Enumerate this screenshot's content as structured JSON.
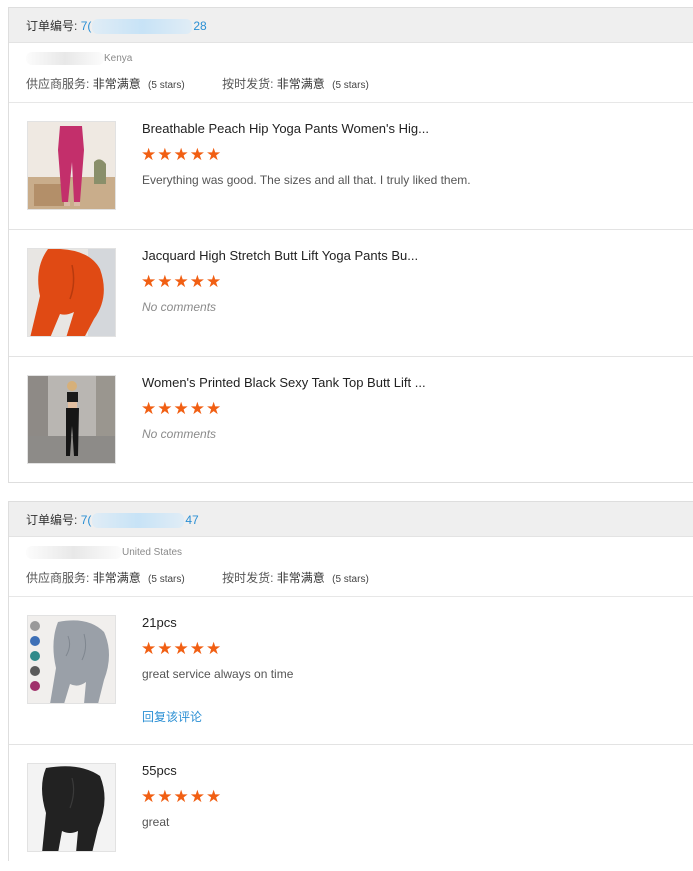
{
  "orders": [
    {
      "order_label": "订单编号:",
      "order_id_start": "7(",
      "order_id_end": "28",
      "buyer_country": "Kenya",
      "supplier_service_label": "供应商服务:",
      "supplier_service_value": "非常满意",
      "supplier_service_stars": "(5 stars)",
      "shipping_label": "按时发货:",
      "shipping_value": "非常满意",
      "shipping_stars": "(5 stars)",
      "items": [
        {
          "title": "Breathable Peach Hip Yoga Pants Women's Hig...",
          "stars": "★★★★★",
          "comment": "Everything was good. The sizes and all that. I truly liked them."
        },
        {
          "title": "Jacquard High Stretch Butt Lift Yoga Pants Bu...",
          "stars": "★★★★★",
          "comment": "No comments"
        },
        {
          "title": "Women's Printed Black Sexy Tank Top Butt Lift ...",
          "stars": "★★★★★",
          "comment": "No comments"
        }
      ]
    },
    {
      "order_label": "订单编号:",
      "order_id_start": "7(",
      "order_id_end": "47",
      "buyer_country": "United States",
      "supplier_service_label": "供应商服务:",
      "supplier_service_value": "非常满意",
      "supplier_service_stars": "(5 stars)",
      "shipping_label": "按时发货:",
      "shipping_value": "非常满意",
      "shipping_stars": "(5 stars)",
      "items": [
        {
          "title": "21pcs",
          "stars": "★★★★★",
          "comment": "great service  always on time",
          "reply_label": "回复该评论"
        },
        {
          "title": "55pcs",
          "stars": "★★★★★",
          "comment": "great"
        }
      ]
    }
  ],
  "colors": {
    "accent_blue": "#2a8fd4",
    "star_orange": "#f15f13"
  }
}
